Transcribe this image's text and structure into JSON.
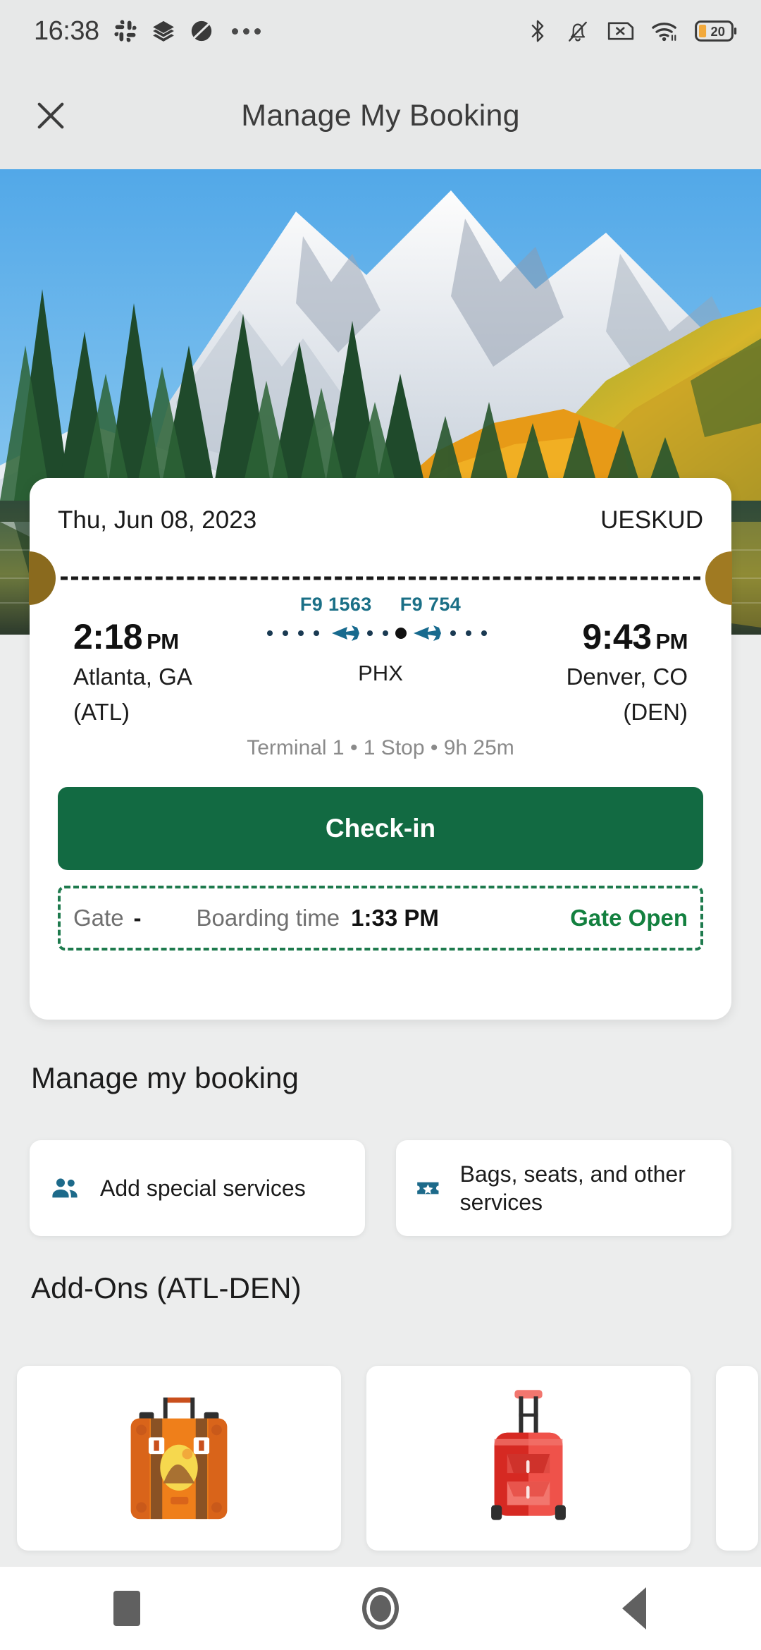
{
  "status_bar": {
    "time": "16:38",
    "left_icons": [
      "slack-icon",
      "layers-icon",
      "planet-icon",
      "more-dots-icon"
    ],
    "right_icons": [
      "bluetooth-icon",
      "notifications-muted-icon",
      "sim-missing-icon",
      "wifi-icon",
      "battery-icon"
    ],
    "battery_level": "20"
  },
  "app_bar": {
    "title": "Manage My Booking",
    "close_icon": "close-icon"
  },
  "hero": {
    "alt": "Snow-capped mountains with autumn forest reflected in an alpine lake"
  },
  "boarding_pass": {
    "date": "Thu, Jun 08, 2023",
    "pnr": "UESKUD",
    "flight_numbers": [
      "F9 1563",
      "F9 754"
    ],
    "departure": {
      "time": "2:18",
      "ampm": "PM",
      "city": "Atlanta, GA",
      "code": "(ATL)"
    },
    "arrival": {
      "time": "9:43",
      "ampm": "PM",
      "city": "Denver, CO",
      "code": "(DEN)"
    },
    "stop_code": "PHX",
    "meta": "Terminal 1 • 1 Stop • 9h 25m",
    "checkin_label": "Check-in",
    "gate_label": "Gate",
    "gate_value": "-",
    "boarding_label": "Boarding time",
    "boarding_value": "1:33 PM",
    "gate_status": "Gate Open"
  },
  "manage_section": {
    "title": "Manage my booking",
    "cards": [
      {
        "label": "Add special services",
        "icon": "people-icon"
      },
      {
        "label": "Bags, seats, and other services",
        "icon": "ticket-star-icon"
      }
    ]
  },
  "addons_section": {
    "title": "Add-Ons (ATL-DEN)",
    "cards": [
      {
        "icon": "vintage-suitcase-icon"
      },
      {
        "icon": "rolling-suitcase-icon"
      },
      {
        "icon": "partial-card"
      }
    ]
  },
  "nav_bar": {
    "buttons": [
      "recents-button",
      "home-button",
      "back-button"
    ]
  },
  "colors": {
    "accent_green": "#126a42",
    "gate_green": "#13803f",
    "flight_teal": "#1a6f86",
    "icon_blue": "#1d6a8a",
    "page_bg": "#eceded"
  }
}
